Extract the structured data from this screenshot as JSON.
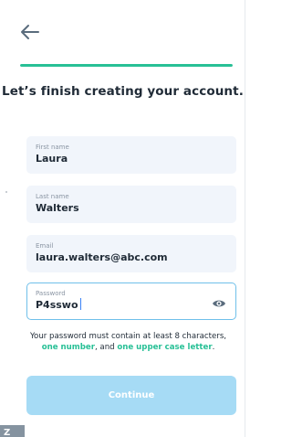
{
  "header": {
    "back_icon": "arrow-left-icon",
    "progress_percent": 100
  },
  "page": {
    "heading": "Let’s finish creating your account."
  },
  "form": {
    "first_name": {
      "label": "First name",
      "value": "Laura"
    },
    "last_name": {
      "label": "Last name",
      "value": "Walters"
    },
    "email": {
      "label": "Email",
      "value": "laura.walters@abc.com"
    },
    "password": {
      "label": "Password",
      "value": "P4sswo",
      "toggle_icon": "eye-icon"
    }
  },
  "hint": {
    "part1": "Your password must contain at least 8 characters,",
    "rule_number": "one number",
    "connector": ", and ",
    "rule_upper": "one upper case letter",
    "end": "."
  },
  "actions": {
    "continue_label": "Continue"
  },
  "colors": {
    "accent_green": "#28c096",
    "button_disabled": "#a6dbf5",
    "focus_border": "#6fc0ea",
    "field_bg": "#f1f5fb",
    "text_dark": "#1f2a36"
  },
  "corner_tab": {
    "text": "Z"
  }
}
